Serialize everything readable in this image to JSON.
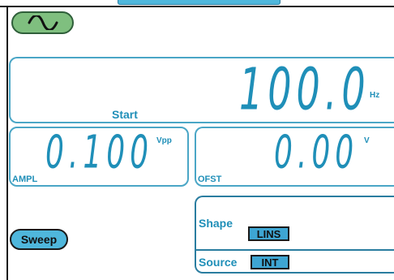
{
  "waveform": {
    "icon": "sine-wave-icon"
  },
  "frequency": {
    "value": "100.0",
    "unit": "Hz",
    "label": "Start"
  },
  "amplitude": {
    "value": "0.100",
    "unit": "Vpp",
    "label": "AMPL"
  },
  "offset": {
    "value": "0.00",
    "unit": "V",
    "label": "OFST"
  },
  "sweep": {
    "label": "Sweep"
  },
  "menu": {
    "shape_label": "Shape",
    "shape_value": "LINS",
    "source_label": "Source",
    "source_value": "INT"
  },
  "colors": {
    "accent": "#1f8fb8",
    "panel_border": "#4aa6c6",
    "waveform_button": "#7fbf7f",
    "tag_fill": "#3ea6d3"
  }
}
